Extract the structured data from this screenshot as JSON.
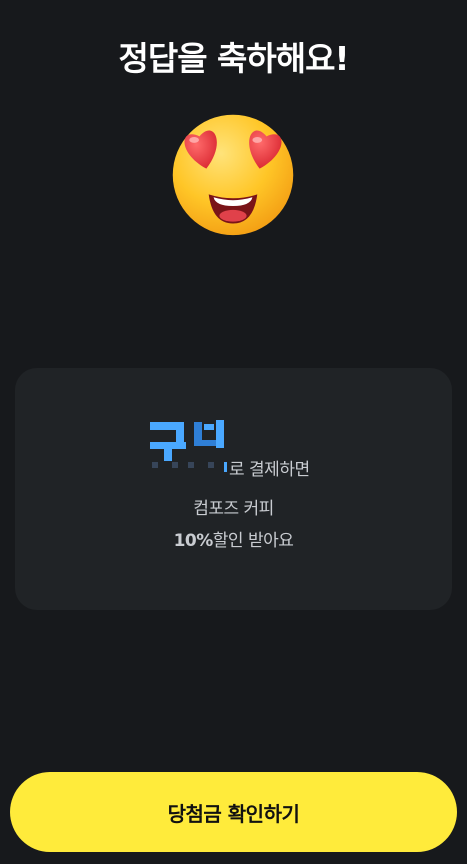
{
  "header": {
    "title": "정답을 축하해요!"
  },
  "hero": {
    "icon": "heart-eyes-emoji-icon"
  },
  "promo": {
    "payment_suffix": "로 결제하면",
    "brand_name": "컴포즈 커피",
    "discount_value": "10%",
    "discount_text": "할인 받아요"
  },
  "cta": {
    "label": "당첨금 확인하기"
  },
  "colors": {
    "background": "#17191c",
    "card": "#202326",
    "button": "#ffeb3b",
    "button_text": "#111111",
    "text": "#ffffff",
    "subtext": "#c9ccd1"
  }
}
